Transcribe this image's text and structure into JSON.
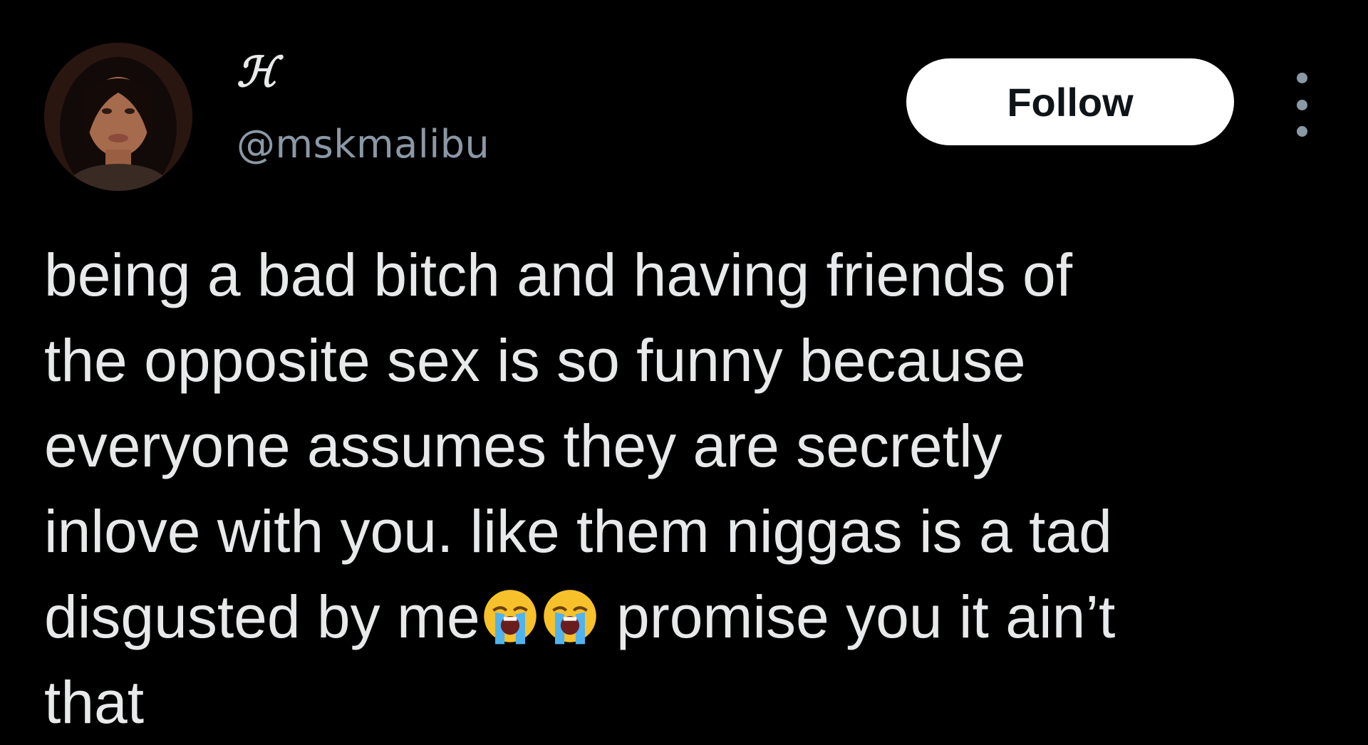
{
  "tweet": {
    "author": {
      "display_name": "ℋ",
      "handle": "@mskmalibu",
      "avatar_icon": "profile-photo"
    },
    "follow_label": "Follow",
    "more_icon": "more-vertical-icon",
    "text_lines": {
      "line1": "being a bad bitch and having friends of",
      "line2": "the opposite sex is so funny because",
      "line3": "everyone assumes they are secretly",
      "line4": "inlove with you. like them niggas is a tad",
      "line5_start": "disgusted by me",
      "line5_end": "promise you it ain’t",
      "line6": "that"
    },
    "emoji": "loudly-crying-face-icon",
    "colors": {
      "background": "#000000",
      "text": "#e7e9ea",
      "secondary": "#8b98a5",
      "follow_bg": "#ffffff",
      "follow_text": "#0f1419"
    }
  }
}
